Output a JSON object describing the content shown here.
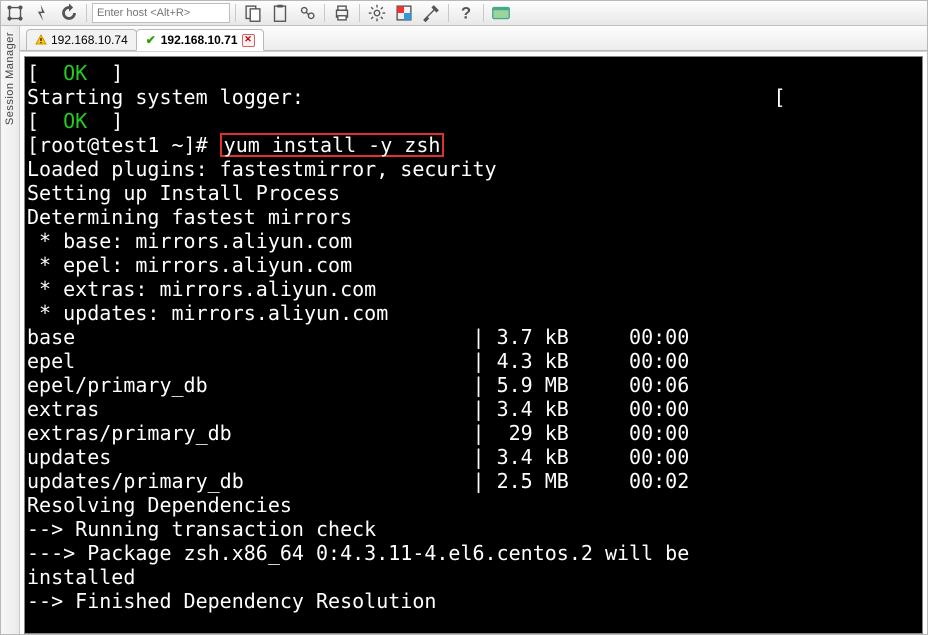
{
  "toolbar": {
    "host_placeholder": "Enter host <Alt+R>"
  },
  "sidebar": {
    "label": "Session Manager"
  },
  "tabs": [
    {
      "label": "192.168.10.74",
      "status": "warn",
      "active": false
    },
    {
      "label": "192.168.10.71",
      "status": "ok",
      "active": true,
      "closable": true
    }
  ],
  "terminal": {
    "ok_text": "OK",
    "bracket_open": "[",
    "bracket_close": "]",
    "line_start_logger_pre": "Starting system logger:",
    "line_start_logger_post": "[",
    "prompt": "[root@test1 ~]# ",
    "command": "yum install -y zsh",
    "after_command": [
      "Loaded plugins: fastestmirror, security",
      "Setting up Install Process",
      "Determining fastest mirrors",
      " * base: mirrors.aliyun.com",
      " * epel: mirrors.aliyun.com",
      " * extras: mirrors.aliyun.com",
      " * updates: mirrors.aliyun.com"
    ],
    "table": [
      {
        "name": "base",
        "size": "3.7 kB",
        "time": "00:00"
      },
      {
        "name": "epel",
        "size": "4.3 kB",
        "time": "00:00"
      },
      {
        "name": "epel/primary_db",
        "size": "5.9 MB",
        "time": "00:06"
      },
      {
        "name": "extras",
        "size": "3.4 kB",
        "time": "00:00"
      },
      {
        "name": "extras/primary_db",
        "size": " 29 kB",
        "time": "00:00"
      },
      {
        "name": "updates",
        "size": "3.4 kB",
        "time": "00:00"
      },
      {
        "name": "updates/primary_db",
        "size": "2.5 MB",
        "time": "00:02"
      }
    ],
    "footer": [
      "Resolving Dependencies",
      "--> Running transaction check",
      "---> Package zsh.x86_64 0:4.3.11-4.el6.centos.2 will be",
      "installed",
      "--> Finished Dependency Resolution"
    ]
  }
}
